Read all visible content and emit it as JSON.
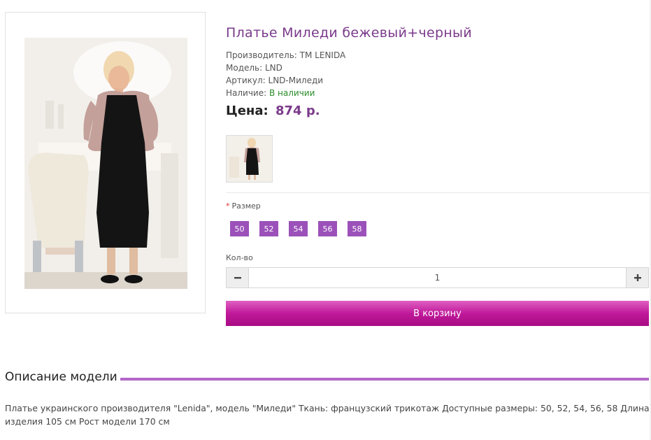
{
  "product": {
    "title": "Платье Миледи бежевый+черный",
    "manufacturer_label": "Производитель:",
    "manufacturer": "TM LENIDA",
    "model_label": "Модель:",
    "model": "LND",
    "article_label": "Артикул:",
    "article": "LND-Миледи",
    "availability_label": "Наличие:",
    "availability": "В наличии",
    "price_label": "Цена:",
    "price": "874 р."
  },
  "options": {
    "required_mark": "*",
    "size_label": "Размер",
    "sizes": [
      "50",
      "52",
      "54",
      "56",
      "58"
    ],
    "size_color": "#9b51b9"
  },
  "quantity": {
    "label": "Кол-во",
    "value": "1",
    "minus_icon": "minus-icon",
    "plus_icon": "plus-icon"
  },
  "cart": {
    "button_label": "В корзину",
    "button_color": "#c0199a"
  },
  "description": {
    "title": "Описание модели",
    "accent_color": "#b468c8",
    "text": "Платье украинского производителя \"Lenida\", модель \"Миледи\" Ткань: французский трикотаж Доступные размеры: 50, 52, 54, 56, 58 Длина изделия 105 см Рост модели 170 см"
  }
}
